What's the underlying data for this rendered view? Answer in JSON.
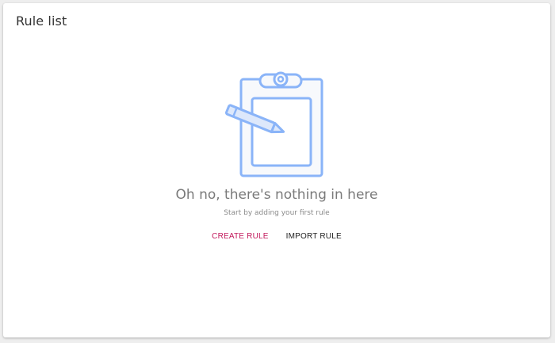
{
  "card": {
    "title": "Rule list"
  },
  "empty_state": {
    "illustration_icon": "clipboard-pencil-icon",
    "title": "Oh no, there's nothing in here",
    "subtitle": "Start by adding your first rule"
  },
  "actions": {
    "create_label": "CREATE RULE",
    "import_label": "IMPORT RULE"
  },
  "colors": {
    "accent": "#c2185b",
    "illustration_stroke": "#8ab4f8",
    "illustration_fill": "#f5f7fb"
  }
}
